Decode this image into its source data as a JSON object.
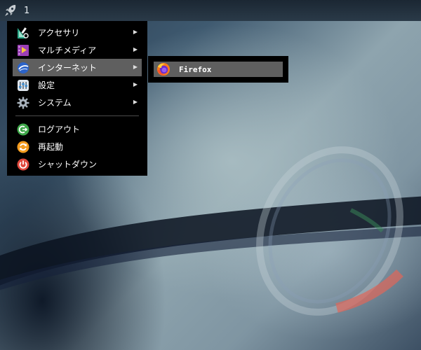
{
  "panel": {
    "workspace": "1"
  },
  "menu": {
    "items": [
      {
        "label": "アクセサリ",
        "icon": "accessories-icon",
        "submenu": true
      },
      {
        "label": "マルチメディア",
        "icon": "multimedia-icon",
        "submenu": true
      },
      {
        "label": "インターネット",
        "icon": "internet-icon",
        "submenu": true,
        "active": true
      },
      {
        "label": "設定",
        "icon": "settings-icon",
        "submenu": true
      },
      {
        "label": "システム",
        "icon": "system-gear-icon",
        "submenu": true
      }
    ],
    "actions": [
      {
        "label": "ログアウト",
        "icon": "logout-icon"
      },
      {
        "label": "再起動",
        "icon": "restart-icon"
      },
      {
        "label": "シャットダウン",
        "icon": "shutdown-icon"
      }
    ],
    "arrow": "▶"
  },
  "submenu": {
    "items": [
      {
        "label": "Firefox",
        "icon": "firefox-icon"
      }
    ]
  },
  "colors": {
    "menu_bg": "#000000",
    "highlight": "#5f5f5f",
    "panel": "#22303d",
    "logout_green": "#3fa84a",
    "restart_orange": "#f39c1f",
    "shutdown_red": "#e0483d"
  }
}
